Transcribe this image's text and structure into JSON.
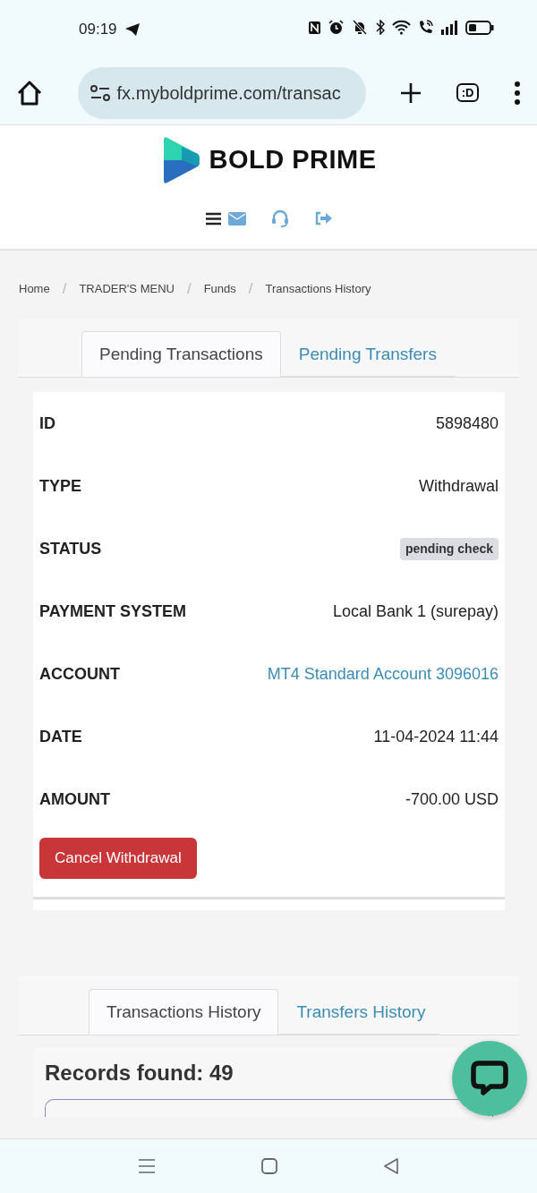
{
  "status_bar": {
    "time": "09:19"
  },
  "browser": {
    "url": "fx.myboldprime.com/transac",
    "tabs_button": ":D"
  },
  "header": {
    "logo_text": "BOLD PRIME"
  },
  "breadcrumb": {
    "separator": "/",
    "items": [
      "Home",
      "TRADER'S MENU",
      "Funds",
      "Transactions History"
    ]
  },
  "pending_tabs": [
    {
      "label": "Pending Transactions",
      "selected": true
    },
    {
      "label": "Pending Transfers",
      "selected": false
    }
  ],
  "details": [
    {
      "label": "ID",
      "value": "5898480",
      "kind": "text"
    },
    {
      "label": "TYPE",
      "value": "Withdrawal",
      "kind": "text"
    },
    {
      "label": "STATUS",
      "value": "pending check",
      "kind": "badge"
    },
    {
      "label": "PAYMENT SYSTEM",
      "value": "Local Bank 1 (surepay)",
      "kind": "text"
    },
    {
      "label": "ACCOUNT",
      "value": "MT4 Standard Account 3096016",
      "kind": "link"
    },
    {
      "label": "DATE",
      "value": "11-04-2024 11:44",
      "kind": "text"
    },
    {
      "label": "AMOUNT",
      "value": "-700.00 USD",
      "kind": "text"
    }
  ],
  "cancel_button": "Cancel Withdrawal",
  "history_tabs": [
    {
      "label": "Transactions History",
      "selected": true
    },
    {
      "label": "Transfers History",
      "selected": false
    }
  ],
  "records_heading": "Records found: 49"
}
